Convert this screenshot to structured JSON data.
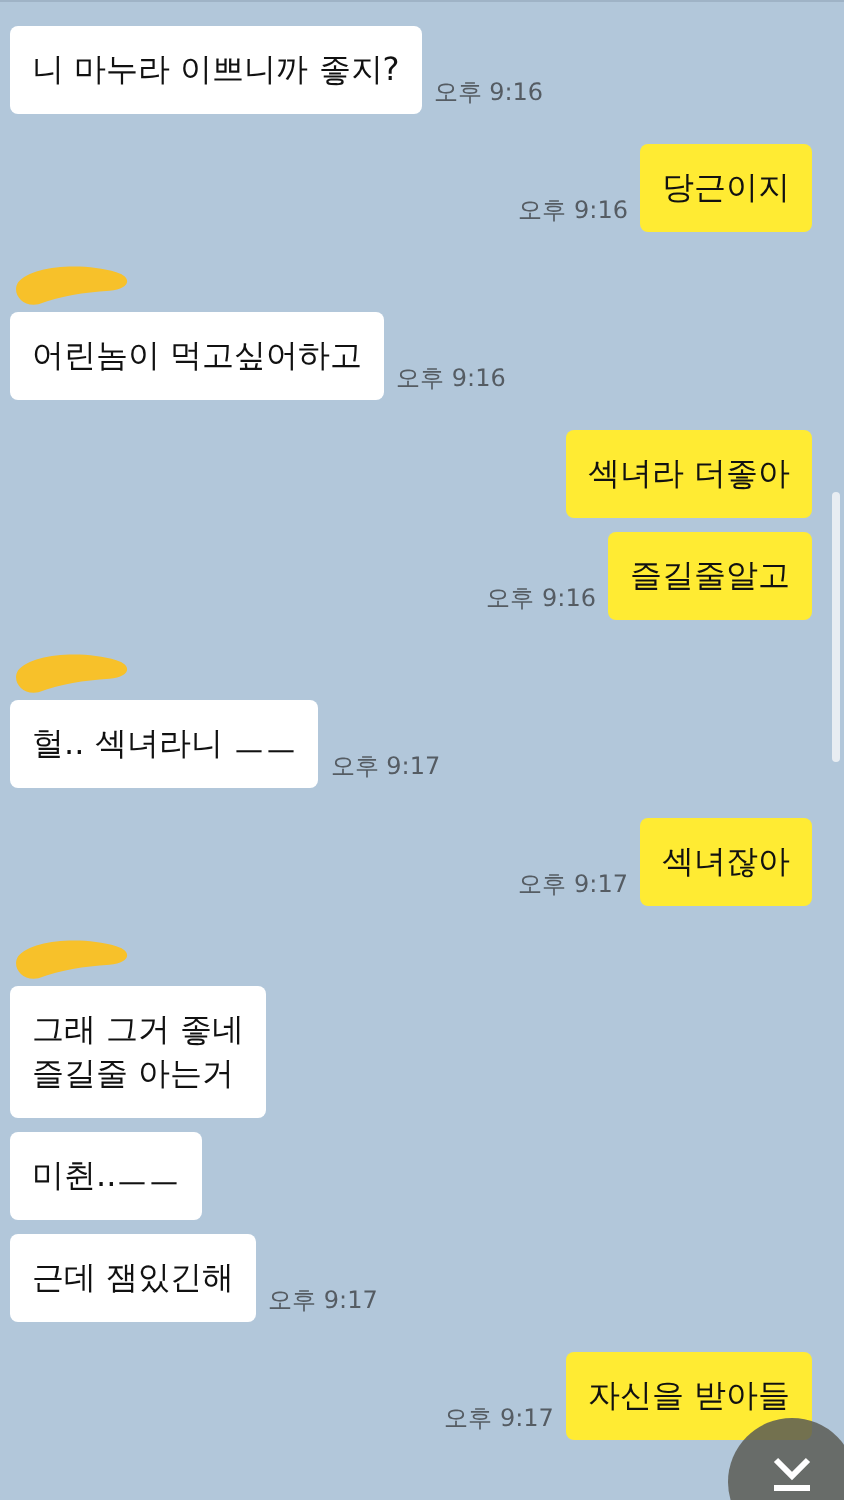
{
  "messages": [
    {
      "kind": "incoming",
      "bubbles": [
        "니 마누라 이쁘니까 좋지?"
      ],
      "time": "오후 9:16"
    },
    {
      "kind": "outgoing",
      "bubbles": [
        "당근이지"
      ],
      "time": "오후 9:16"
    },
    {
      "kind": "incoming",
      "name_hidden": true,
      "bubbles": [
        "어린놈이 먹고싶어하고"
      ],
      "time": "오후 9:16"
    },
    {
      "kind": "outgoing",
      "bubbles": [
        "섹녀라 더좋아",
        "즐길줄알고"
      ],
      "time": "오후 9:16"
    },
    {
      "kind": "incoming",
      "name_hidden": true,
      "bubbles": [
        "헐.. 섹녀라니  ㅡㅡ"
      ],
      "time": "오후 9:17"
    },
    {
      "kind": "outgoing",
      "bubbles": [
        "섹녀잖아"
      ],
      "time": "오후 9:17"
    },
    {
      "kind": "incoming",
      "name_hidden": true,
      "bubbles": [
        "그래 그거 좋네\n즐길줄 아는거",
        "미췬..ㅡㅡ",
        "근데 잼있긴해"
      ],
      "time": "오후 9:17"
    },
    {
      "kind": "outgoing",
      "bubbles": [
        "자신을 받아들"
      ],
      "time": "오후 9:17"
    }
  ]
}
